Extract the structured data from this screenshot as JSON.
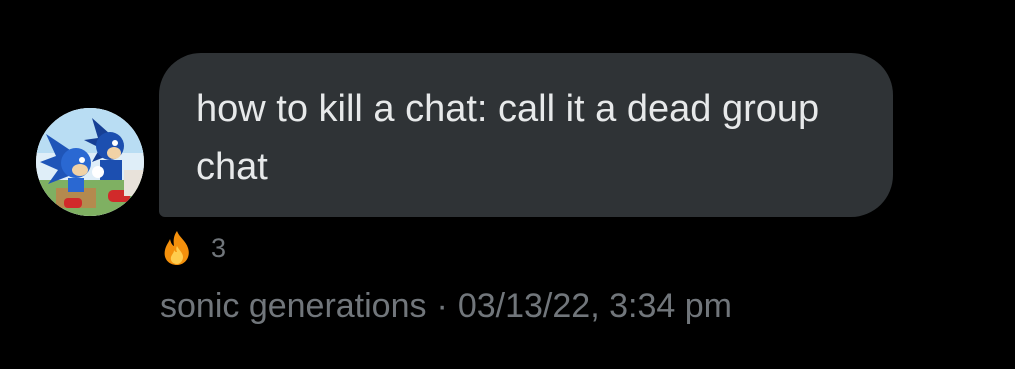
{
  "message": {
    "text": "how to kill a chat: call it a dead group chat",
    "sender_name": "sonic generations",
    "separator": "·",
    "timestamp": "03/13/22, 3:34 pm"
  },
  "reaction": {
    "emoji_icon": "fire-icon",
    "count": "3"
  },
  "colors": {
    "background": "#000000",
    "bubble": "#2f3336",
    "message_text": "#e7e9ea",
    "secondary_text": "#71767b"
  }
}
